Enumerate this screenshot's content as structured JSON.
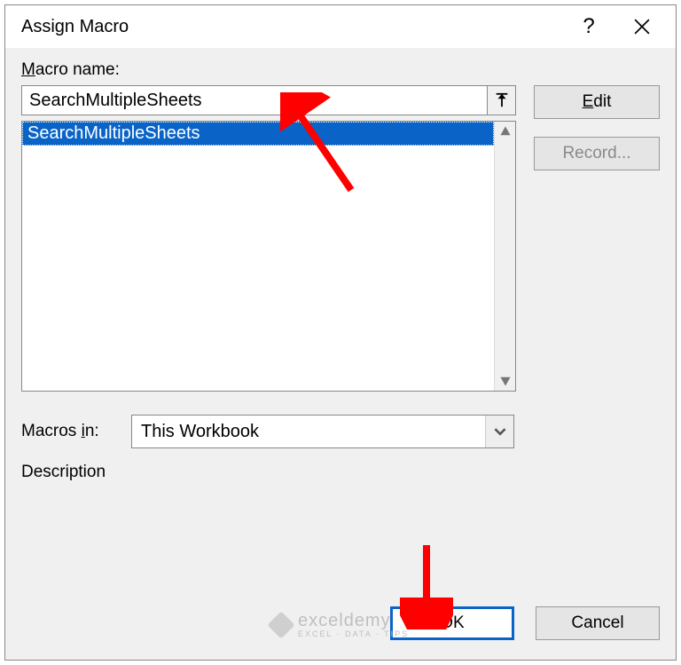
{
  "dialog": {
    "title": "Assign Macro"
  },
  "labels": {
    "macro_name_prefix": "M",
    "macro_name_rest": "acro name:",
    "macros_in_prefix": "Macros ",
    "macros_in_underline": "i",
    "macros_in_rest": "n:",
    "description": "Description"
  },
  "macro_name_value": "SearchMultipleSheets",
  "macro_list": {
    "items": [
      "SearchMultipleSheets"
    ],
    "selected_index": 0
  },
  "combo": {
    "selected": "This Workbook"
  },
  "buttons": {
    "edit_prefix": "E",
    "edit_rest": "dit",
    "record": "Record...",
    "ok": "OK",
    "cancel": "Cancel"
  },
  "watermark": {
    "brand": "exceldemy",
    "tagline": "EXCEL · DATA · TIPS"
  }
}
